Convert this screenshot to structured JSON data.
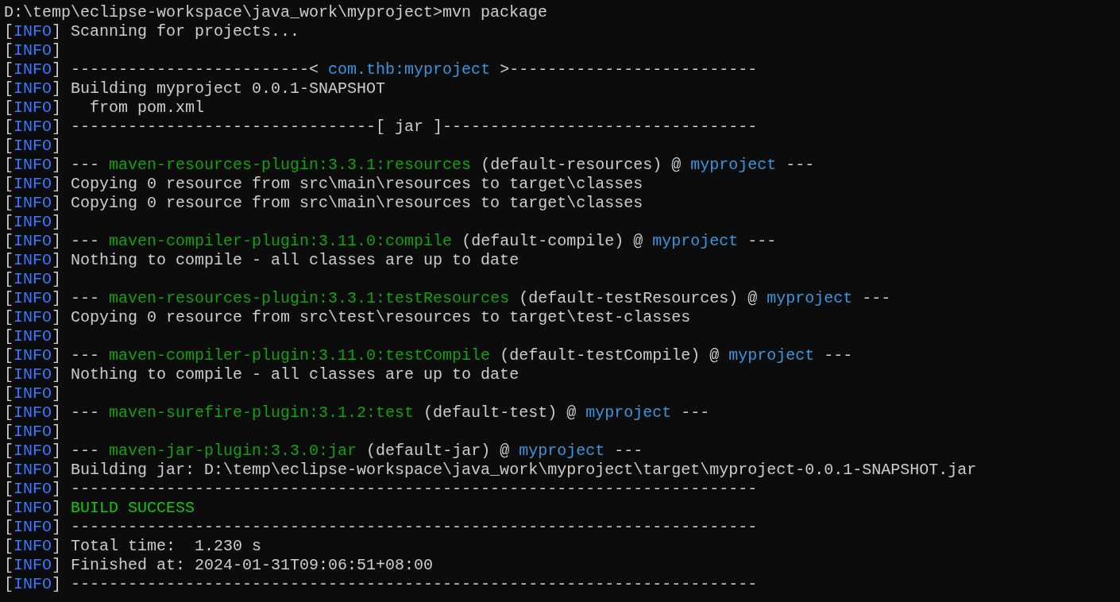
{
  "terminal": {
    "lines": [
      {
        "segments": [
          {
            "text": "D:\\temp\\eclipse-workspace\\java_work\\myproject>mvn package",
            "color": "#cccccc"
          }
        ]
      },
      {
        "segments": [
          {
            "text": "[",
            "color": "#cccccc"
          },
          {
            "text": "INFO",
            "color": "#3b78ff"
          },
          {
            "text": "] Scanning for projects...",
            "color": "#cccccc"
          }
        ]
      },
      {
        "segments": [
          {
            "text": "[",
            "color": "#cccccc"
          },
          {
            "text": "INFO",
            "color": "#3b78ff"
          },
          {
            "text": "]",
            "color": "#cccccc"
          }
        ]
      },
      {
        "segments": [
          {
            "text": "[",
            "color": "#cccccc"
          },
          {
            "text": "INFO",
            "color": "#3b78ff"
          },
          {
            "text": "] -------------------------< ",
            "color": "#cccccc"
          },
          {
            "text": "com.thb:myproject",
            "color": "#3a96dd"
          },
          {
            "text": " >--------------------------",
            "color": "#cccccc"
          }
        ]
      },
      {
        "segments": [
          {
            "text": "[",
            "color": "#cccccc"
          },
          {
            "text": "INFO",
            "color": "#3b78ff"
          },
          {
            "text": "] Building myproject 0.0.1-SNAPSHOT",
            "color": "#cccccc"
          }
        ]
      },
      {
        "segments": [
          {
            "text": "[",
            "color": "#cccccc"
          },
          {
            "text": "INFO",
            "color": "#3b78ff"
          },
          {
            "text": "]   from pom.xml",
            "color": "#cccccc"
          }
        ]
      },
      {
        "segments": [
          {
            "text": "[",
            "color": "#cccccc"
          },
          {
            "text": "INFO",
            "color": "#3b78ff"
          },
          {
            "text": "] --------------------------------[ jar ]---------------------------------",
            "color": "#cccccc"
          }
        ]
      },
      {
        "segments": [
          {
            "text": "[",
            "color": "#cccccc"
          },
          {
            "text": "INFO",
            "color": "#3b78ff"
          },
          {
            "text": "]",
            "color": "#cccccc"
          }
        ]
      },
      {
        "segments": [
          {
            "text": "[",
            "color": "#cccccc"
          },
          {
            "text": "INFO",
            "color": "#3b78ff"
          },
          {
            "text": "] --- ",
            "color": "#cccccc"
          },
          {
            "text": "maven-resources-plugin:3.3.1:resources",
            "color": "#13a10e"
          },
          {
            "text": " (default-resources) @ ",
            "color": "#cccccc"
          },
          {
            "text": "myproject",
            "color": "#3a96dd"
          },
          {
            "text": " ---",
            "color": "#cccccc"
          }
        ]
      },
      {
        "segments": [
          {
            "text": "[",
            "color": "#cccccc"
          },
          {
            "text": "INFO",
            "color": "#3b78ff"
          },
          {
            "text": "] Copying 0 resource from src\\main\\resources to target\\classes",
            "color": "#cccccc"
          }
        ]
      },
      {
        "segments": [
          {
            "text": "[",
            "color": "#cccccc"
          },
          {
            "text": "INFO",
            "color": "#3b78ff"
          },
          {
            "text": "] Copying 0 resource from src\\main\\resources to target\\classes",
            "color": "#cccccc"
          }
        ]
      },
      {
        "segments": [
          {
            "text": "[",
            "color": "#cccccc"
          },
          {
            "text": "INFO",
            "color": "#3b78ff"
          },
          {
            "text": "]",
            "color": "#cccccc"
          }
        ]
      },
      {
        "segments": [
          {
            "text": "[",
            "color": "#cccccc"
          },
          {
            "text": "INFO",
            "color": "#3b78ff"
          },
          {
            "text": "] --- ",
            "color": "#cccccc"
          },
          {
            "text": "maven-compiler-plugin:3.11.0:compile",
            "color": "#13a10e"
          },
          {
            "text": " (default-compile) @ ",
            "color": "#cccccc"
          },
          {
            "text": "myproject",
            "color": "#3a96dd"
          },
          {
            "text": " ---",
            "color": "#cccccc"
          }
        ]
      },
      {
        "segments": [
          {
            "text": "[",
            "color": "#cccccc"
          },
          {
            "text": "INFO",
            "color": "#3b78ff"
          },
          {
            "text": "] Nothing to compile - all classes are up to date",
            "color": "#cccccc"
          }
        ]
      },
      {
        "segments": [
          {
            "text": "[",
            "color": "#cccccc"
          },
          {
            "text": "INFO",
            "color": "#3b78ff"
          },
          {
            "text": "]",
            "color": "#cccccc"
          }
        ]
      },
      {
        "segments": [
          {
            "text": "[",
            "color": "#cccccc"
          },
          {
            "text": "INFO",
            "color": "#3b78ff"
          },
          {
            "text": "] --- ",
            "color": "#cccccc"
          },
          {
            "text": "maven-resources-plugin:3.3.1:testResources",
            "color": "#13a10e"
          },
          {
            "text": " (default-testResources) @ ",
            "color": "#cccccc"
          },
          {
            "text": "myproject",
            "color": "#3a96dd"
          },
          {
            "text": " ---",
            "color": "#cccccc"
          }
        ]
      },
      {
        "segments": [
          {
            "text": "[",
            "color": "#cccccc"
          },
          {
            "text": "INFO",
            "color": "#3b78ff"
          },
          {
            "text": "] Copying 0 resource from src\\test\\resources to target\\test-classes",
            "color": "#cccccc"
          }
        ]
      },
      {
        "segments": [
          {
            "text": "[",
            "color": "#cccccc"
          },
          {
            "text": "INFO",
            "color": "#3b78ff"
          },
          {
            "text": "]",
            "color": "#cccccc"
          }
        ]
      },
      {
        "segments": [
          {
            "text": "[",
            "color": "#cccccc"
          },
          {
            "text": "INFO",
            "color": "#3b78ff"
          },
          {
            "text": "] --- ",
            "color": "#cccccc"
          },
          {
            "text": "maven-compiler-plugin:3.11.0:testCompile",
            "color": "#13a10e"
          },
          {
            "text": " (default-testCompile) @ ",
            "color": "#cccccc"
          },
          {
            "text": "myproject",
            "color": "#3a96dd"
          },
          {
            "text": " ---",
            "color": "#cccccc"
          }
        ]
      },
      {
        "segments": [
          {
            "text": "[",
            "color": "#cccccc"
          },
          {
            "text": "INFO",
            "color": "#3b78ff"
          },
          {
            "text": "] Nothing to compile - all classes are up to date",
            "color": "#cccccc"
          }
        ]
      },
      {
        "segments": [
          {
            "text": "[",
            "color": "#cccccc"
          },
          {
            "text": "INFO",
            "color": "#3b78ff"
          },
          {
            "text": "]",
            "color": "#cccccc"
          }
        ]
      },
      {
        "segments": [
          {
            "text": "[",
            "color": "#cccccc"
          },
          {
            "text": "INFO",
            "color": "#3b78ff"
          },
          {
            "text": "] --- ",
            "color": "#cccccc"
          },
          {
            "text": "maven-surefire-plugin:3.1.2:test",
            "color": "#13a10e"
          },
          {
            "text": " (default-test) @ ",
            "color": "#cccccc"
          },
          {
            "text": "myproject",
            "color": "#3a96dd"
          },
          {
            "text": " ---",
            "color": "#cccccc"
          }
        ]
      },
      {
        "segments": [
          {
            "text": "[",
            "color": "#cccccc"
          },
          {
            "text": "INFO",
            "color": "#3b78ff"
          },
          {
            "text": "]",
            "color": "#cccccc"
          }
        ]
      },
      {
        "segments": [
          {
            "text": "[",
            "color": "#cccccc"
          },
          {
            "text": "INFO",
            "color": "#3b78ff"
          },
          {
            "text": "] --- ",
            "color": "#cccccc"
          },
          {
            "text": "maven-jar-plugin:3.3.0:jar",
            "color": "#13a10e"
          },
          {
            "text": " (default-jar) @ ",
            "color": "#cccccc"
          },
          {
            "text": "myproject",
            "color": "#3a96dd"
          },
          {
            "text": " ---",
            "color": "#cccccc"
          }
        ]
      },
      {
        "segments": [
          {
            "text": "[",
            "color": "#cccccc"
          },
          {
            "text": "INFO",
            "color": "#3b78ff"
          },
          {
            "text": "] Building jar: D:\\temp\\eclipse-workspace\\java_work\\myproject\\target\\myproject-0.0.1-SNAPSHOT.jar",
            "color": "#cccccc"
          }
        ]
      },
      {
        "segments": [
          {
            "text": "[",
            "color": "#cccccc"
          },
          {
            "text": "INFO",
            "color": "#3b78ff"
          },
          {
            "text": "] ------------------------------------------------------------------------",
            "color": "#cccccc"
          }
        ]
      },
      {
        "segments": [
          {
            "text": "[",
            "color": "#cccccc"
          },
          {
            "text": "INFO",
            "color": "#3b78ff"
          },
          {
            "text": "] ",
            "color": "#cccccc"
          },
          {
            "text": "BUILD SUCCESS",
            "color": "#16c60c"
          }
        ]
      },
      {
        "segments": [
          {
            "text": "[",
            "color": "#cccccc"
          },
          {
            "text": "INFO",
            "color": "#3b78ff"
          },
          {
            "text": "] ------------------------------------------------------------------------",
            "color": "#cccccc"
          }
        ]
      },
      {
        "segments": [
          {
            "text": "[",
            "color": "#cccccc"
          },
          {
            "text": "INFO",
            "color": "#3b78ff"
          },
          {
            "text": "] Total time:  1.230 s",
            "color": "#cccccc"
          }
        ]
      },
      {
        "segments": [
          {
            "text": "[",
            "color": "#cccccc"
          },
          {
            "text": "INFO",
            "color": "#3b78ff"
          },
          {
            "text": "] Finished at: 2024-01-31T09:06:51+08:00",
            "color": "#cccccc"
          }
        ]
      },
      {
        "segments": [
          {
            "text": "[",
            "color": "#cccccc"
          },
          {
            "text": "INFO",
            "color": "#3b78ff"
          },
          {
            "text": "] ------------------------------------------------------------------------",
            "color": "#cccccc"
          }
        ]
      }
    ]
  }
}
